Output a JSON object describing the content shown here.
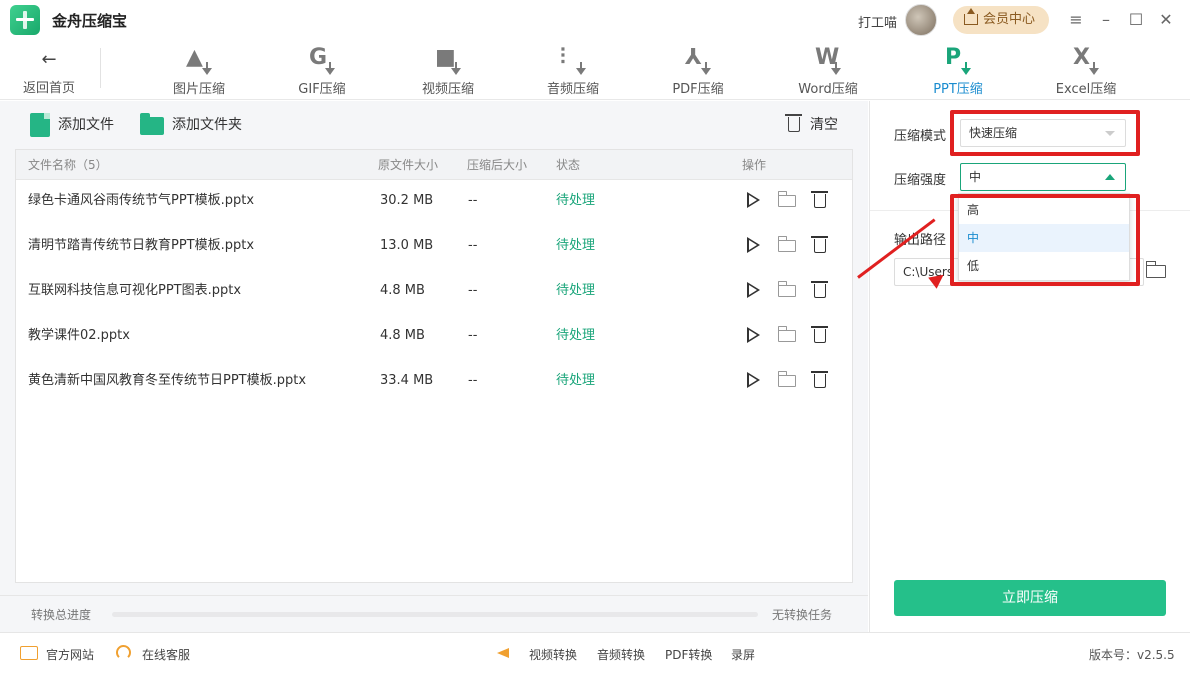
{
  "app": {
    "title": "金舟压缩宝"
  },
  "header": {
    "user_name": "打工喵",
    "member_label": "会员中心"
  },
  "nav": {
    "back_label": "返回首页",
    "tabs": [
      {
        "label": "图片压缩",
        "icon": "image-compress-icon",
        "glyph": "▲"
      },
      {
        "label": "GIF压缩",
        "icon": "gif-compress-icon",
        "glyph": "G"
      },
      {
        "label": "视频压缩",
        "icon": "video-compress-icon",
        "glyph": "■"
      },
      {
        "label": "音频压缩",
        "icon": "audio-compress-icon",
        "glyph": "⫶"
      },
      {
        "label": "PDF压缩",
        "icon": "pdf-compress-icon",
        "glyph": "⅄"
      },
      {
        "label": "Word压缩",
        "icon": "word-compress-icon",
        "glyph": "W"
      },
      {
        "label": "PPT压缩",
        "icon": "ppt-compress-icon",
        "glyph": "P"
      },
      {
        "label": "Excel压缩",
        "icon": "excel-compress-icon",
        "glyph": "X"
      }
    ],
    "active_tab": "PPT压缩"
  },
  "actions": {
    "add_file": "添加文件",
    "add_folder": "添加文件夹",
    "clear": "清空"
  },
  "table": {
    "headers": {
      "name": "文件名称（5）",
      "original_size": "原文件大小",
      "compressed_size": "压缩后大小",
      "status": "状态",
      "actions": "操作"
    },
    "rows": [
      {
        "name": "绿色卡通风谷雨传统节气PPT模板.pptx",
        "size": "30.2 MB",
        "compressed": "--",
        "status": "待处理"
      },
      {
        "name": "清明节踏青传统节日教育PPT模板.pptx",
        "size": "13.0 MB",
        "compressed": "--",
        "status": "待处理"
      },
      {
        "name": "互联网科技信息可视化PPT图表.pptx",
        "size": "4.8 MB",
        "compressed": "--",
        "status": "待处理"
      },
      {
        "name": "教学课件02.pptx",
        "size": "4.8 MB",
        "compressed": "--",
        "status": "待处理"
      },
      {
        "name": "黄色清新中国风教育冬至传统节日PPT模板.pptx",
        "size": "33.4 MB",
        "compressed": "--",
        "status": "待处理"
      }
    ]
  },
  "progress": {
    "label": "转换总进度",
    "status": "无转换任务",
    "value": 0
  },
  "settings": {
    "mode_label": "压缩模式",
    "mode_value": "快速压缩",
    "strength_label": "压缩强度",
    "strength_value": "中",
    "strength_options": [
      "高",
      "中",
      "低"
    ],
    "output_label": "输出路径",
    "output_path": "C:\\Users"
  },
  "compress_button": "立即压缩",
  "footer": {
    "website": "官方网站",
    "support": "在线客服",
    "links": [
      "视频转换",
      "音频转换",
      "PDF转换",
      "录屏"
    ],
    "version": "版本号：v2.5.5"
  },
  "colors": {
    "accent": "#1aa57a",
    "button": "#25c08a",
    "highlight": "#e02020",
    "active_tab_text": "#1a8ccf"
  }
}
